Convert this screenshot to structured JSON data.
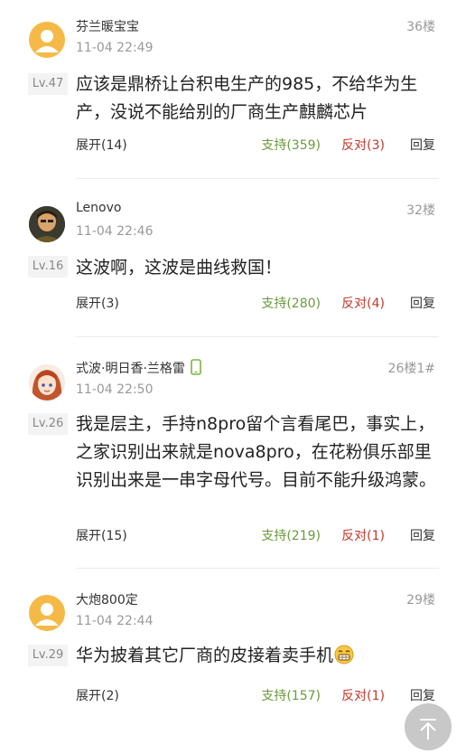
{
  "comments": [
    {
      "username": "芬兰暖宝宝",
      "floor": "36楼",
      "time": "11-04 22:49",
      "level": "Lv.47",
      "text": "应该是鼎桥让台积电生产的985，不给华为生产，没说不能给别的厂商生产麒麟芯片",
      "expand": "展开(14)",
      "support": "支持(359)",
      "oppose": "反对(3)",
      "reply": "回复"
    },
    {
      "username": "Lenovo",
      "floor": "32楼",
      "time": "11-04 22:46",
      "level": "Lv.16",
      "text": "这波啊，这波是曲线救国！",
      "expand": "展开(3)",
      "support": "支持(280)",
      "oppose": "反对(4)",
      "reply": "回复"
    },
    {
      "username": "式波·明日香·兰格雷",
      "floor": "26楼1#",
      "time": "11-04 22:50",
      "level": "Lv.26",
      "text": "我是层主，手持n8pro留个言看尾巴，事实上，之家识别出来就是nova8pro，在花粉俱乐部里识别出来是一串字母代号。目前不能升级鸿蒙。",
      "expand": "展开(15)",
      "support": "支持(219)",
      "oppose": "反对(1)",
      "reply": "回复"
    },
    {
      "username": "大炮800定",
      "floor": "29楼",
      "time": "11-04 22:44",
      "level": "Lv.29",
      "text": "华为披着其它厂商的皮接着卖手机",
      "expand": "展开(2)",
      "support": "支持(157)",
      "oppose": "反对(1)",
      "reply": "回复"
    }
  ],
  "colors": {
    "support": "#6b9a3d",
    "oppose": "#c0392b",
    "avatar_default": "#f5b947",
    "device_icon": "#7cb342"
  },
  "icons": {
    "device": "phone-icon",
    "emoji": "grin-emoji-icon",
    "back_to_top": "arrow-up-icon"
  }
}
